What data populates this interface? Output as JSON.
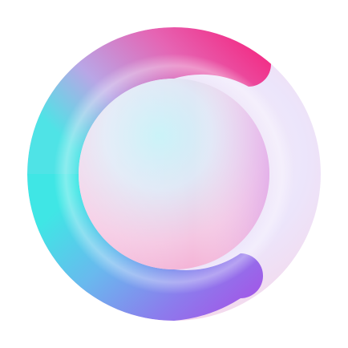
{
  "logo": {
    "icon": "c-ring-app-icon",
    "background": "#ffffff",
    "colors": {
      "disc_light": "#f3e6f7",
      "disc_lavender": "#dcd6fb",
      "disc_pink": "#fbd7e6",
      "ring_cyan": "#3ee6e4",
      "ring_sky": "#6fd2ef",
      "ring_blue": "#7c8cf0",
      "ring_purple": "#a25ae8",
      "ring_magenta": "#f2358f",
      "ring_pink": "#f06aa6",
      "inner_cyan": "#b3eef6",
      "inner_pink": "#f7b8d8",
      "inner_lilac": "#dcbaf6"
    }
  }
}
